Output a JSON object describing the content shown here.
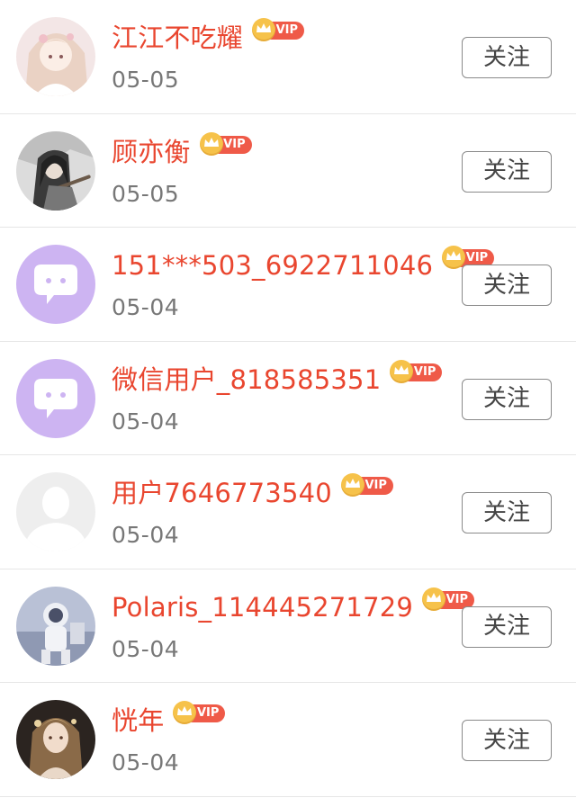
{
  "users": [
    {
      "name": "江江不吃耀",
      "vip_label": "VIP",
      "date": "05-05",
      "follow_label": "关注",
      "avatar": "anime-girl-avatar"
    },
    {
      "name": "顾亦衡",
      "vip_label": "VIP",
      "date": "05-05",
      "follow_label": "关注",
      "avatar": "ancient-style-man-avatar"
    },
    {
      "name": "151***503_6922711046",
      "vip_label": "VIP",
      "date": "05-04",
      "follow_label": "关注",
      "avatar": "default-chat-bubble-avatar"
    },
    {
      "name": "微信用户_818585351",
      "vip_label": "VIP",
      "date": "05-04",
      "follow_label": "关注",
      "avatar": "default-chat-bubble-avatar"
    },
    {
      "name": "用户7646773540",
      "vip_label": "VIP",
      "date": "05-04",
      "follow_label": "关注",
      "avatar": "default-person-silhouette-avatar"
    },
    {
      "name": "Polaris_114445271729",
      "vip_label": "VIP",
      "date": "05-04",
      "follow_label": "关注",
      "avatar": "astronaut-avatar"
    },
    {
      "name": "恍年",
      "vip_label": "VIP",
      "date": "05-04",
      "follow_label": "关注",
      "avatar": "portrait-woman-avatar"
    }
  ],
  "colors": {
    "name_red": "#e9462f",
    "vip_pill": "#ef5a48",
    "crown_gold": "#f6c24a",
    "date_gray": "#777777",
    "default_avatar_purple": "#cdb4f2"
  }
}
